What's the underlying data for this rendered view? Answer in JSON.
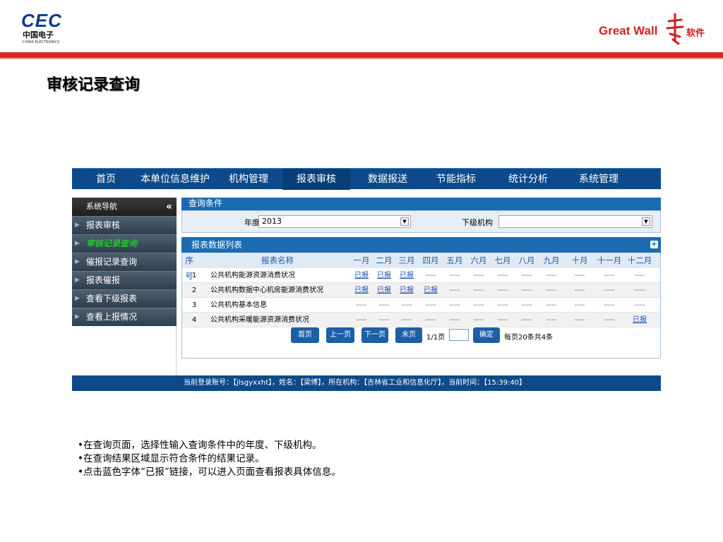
{
  "header": {
    "left_logo": {
      "text": "CEC",
      "cn": "中国电子",
      "en": "CHINA ELECTRONICS"
    },
    "right_logo": {
      "text": "Great Wall",
      "cn": "软件"
    }
  },
  "slide_title": "审核记录查询",
  "nav": {
    "items": [
      {
        "label": "首页"
      },
      {
        "label": "本单位信息维护"
      },
      {
        "label": "机构管理"
      },
      {
        "label": "报表审核"
      },
      {
        "label": "数据报送"
      },
      {
        "label": "节能指标"
      },
      {
        "label": "统计分析"
      },
      {
        "label": "系统管理"
      }
    ],
    "active": "报表审核"
  },
  "sidebar": {
    "header": "系统导航",
    "collapse_glyph": "«",
    "items": [
      {
        "label": "报表审核"
      },
      {
        "label": "审核记录查询"
      },
      {
        "label": "催报记录查询"
      },
      {
        "label": "报表催报"
      },
      {
        "label": "查看下级报表"
      },
      {
        "label": "查看上报情况"
      }
    ],
    "selected": "审核记录查询"
  },
  "query": {
    "title": "查询条件",
    "year_label": "年度",
    "year_value": "2013",
    "org_label": "下级机构",
    "org_value": ""
  },
  "report_list": {
    "title": "报表数据列表",
    "columns": [
      "序号",
      "报表名称",
      "一月",
      "二月",
      "三月",
      "四月",
      "五月",
      "六月",
      "七月",
      "八月",
      "九月",
      "十月",
      "十一月",
      "十二月"
    ],
    "rows": [
      {
        "no": "1",
        "name": "公共机构能源资源消费状况",
        "months": [
          "已报",
          "已报",
          "已报",
          "----",
          "----",
          "----",
          "----",
          "----",
          "----",
          "----",
          "----",
          "----"
        ]
      },
      {
        "no": "2",
        "name": "公共机构数据中心机房能源消费状况",
        "months": [
          "已报",
          "已报",
          "已报",
          "已报",
          "----",
          "----",
          "----",
          "----",
          "----",
          "----",
          "----",
          "----"
        ]
      },
      {
        "no": "3",
        "name": "公共机构基本信息",
        "months": [
          "----",
          "----",
          "----",
          "----",
          "----",
          "----",
          "----",
          "----",
          "----",
          "----",
          "----",
          "----"
        ]
      },
      {
        "no": "4",
        "name": "公共机构采暖能源资源消费状况",
        "months": [
          "----",
          "----",
          "----",
          "----",
          "----",
          "----",
          "----",
          "----",
          "----",
          "----",
          "----",
          "已报"
        ]
      }
    ]
  },
  "pager": {
    "first": "首页",
    "prev": "上一页",
    "next": "下一页",
    "last": "末页",
    "page_info": "1/1页",
    "confirm": "确定",
    "summary": "每页20条共4条"
  },
  "status_bar": "当前登录账号：【jlsgyxxht】，姓名：【梁博】，所在机构：【吉林省工业和信息化厅】，当前时间：【15:39:40】",
  "bullets": [
    "•在查询页面，选择性输入查询条件中的年度、下级机构。",
    "•在查询结果区域显示符合条件的结果记录。",
    "•点击蓝色字体“已报”链接，可以进入页面查看报表具体信息。"
  ],
  "colors": {
    "nav_bg": "#0d4a8c",
    "panel_blue": "#1b6bb3",
    "brand_red": "#d9281e",
    "selected_green": "#22c32e",
    "link_blue": "#1a4fb3"
  }
}
